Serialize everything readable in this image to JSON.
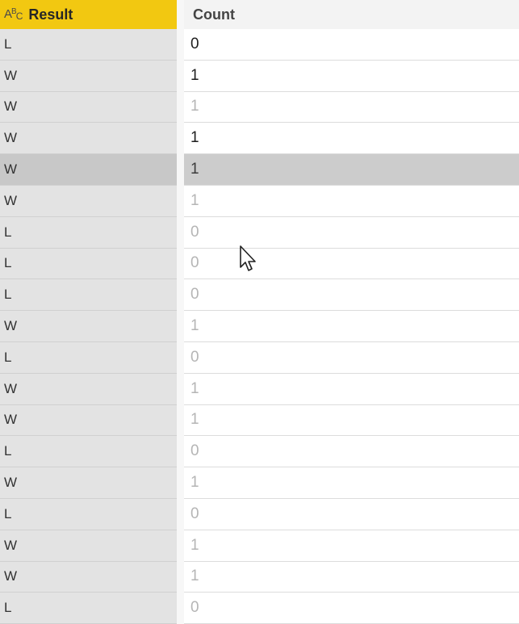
{
  "columns": {
    "result": {
      "label": "Result",
      "type_icon": "text-type-icon",
      "type_icon_text": "ABC"
    },
    "count": {
      "label": "Count"
    }
  },
  "rows": [
    {
      "result": "L",
      "count": "0",
      "tone": "dark"
    },
    {
      "result": "W",
      "count": "1",
      "tone": "dark"
    },
    {
      "result": "W",
      "count": "1",
      "tone": "light"
    },
    {
      "result": "W",
      "count": "1",
      "tone": "dark"
    },
    {
      "result": "W",
      "count": "1",
      "tone": "selected"
    },
    {
      "result": "W",
      "count": "1",
      "tone": "light"
    },
    {
      "result": "L",
      "count": "0",
      "tone": "light"
    },
    {
      "result": "L",
      "count": "0",
      "tone": "light"
    },
    {
      "result": "L",
      "count": "0",
      "tone": "light"
    },
    {
      "result": "W",
      "count": "1",
      "tone": "light"
    },
    {
      "result": "L",
      "count": "0",
      "tone": "light"
    },
    {
      "result": "W",
      "count": "1",
      "tone": "light"
    },
    {
      "result": "W",
      "count": "1",
      "tone": "light"
    },
    {
      "result": "L",
      "count": "0",
      "tone": "light"
    },
    {
      "result": "W",
      "count": "1",
      "tone": "light"
    },
    {
      "result": "L",
      "count": "0",
      "tone": "light"
    },
    {
      "result": "W",
      "count": "1",
      "tone": "light"
    },
    {
      "result": "W",
      "count": "1",
      "tone": "light"
    },
    {
      "result": "L",
      "count": "0",
      "tone": "light"
    }
  ],
  "colors": {
    "header_accent": "#f2c811",
    "selected_row": "#cccccc"
  },
  "cursor": {
    "icon": "mouse-pointer-icon"
  }
}
